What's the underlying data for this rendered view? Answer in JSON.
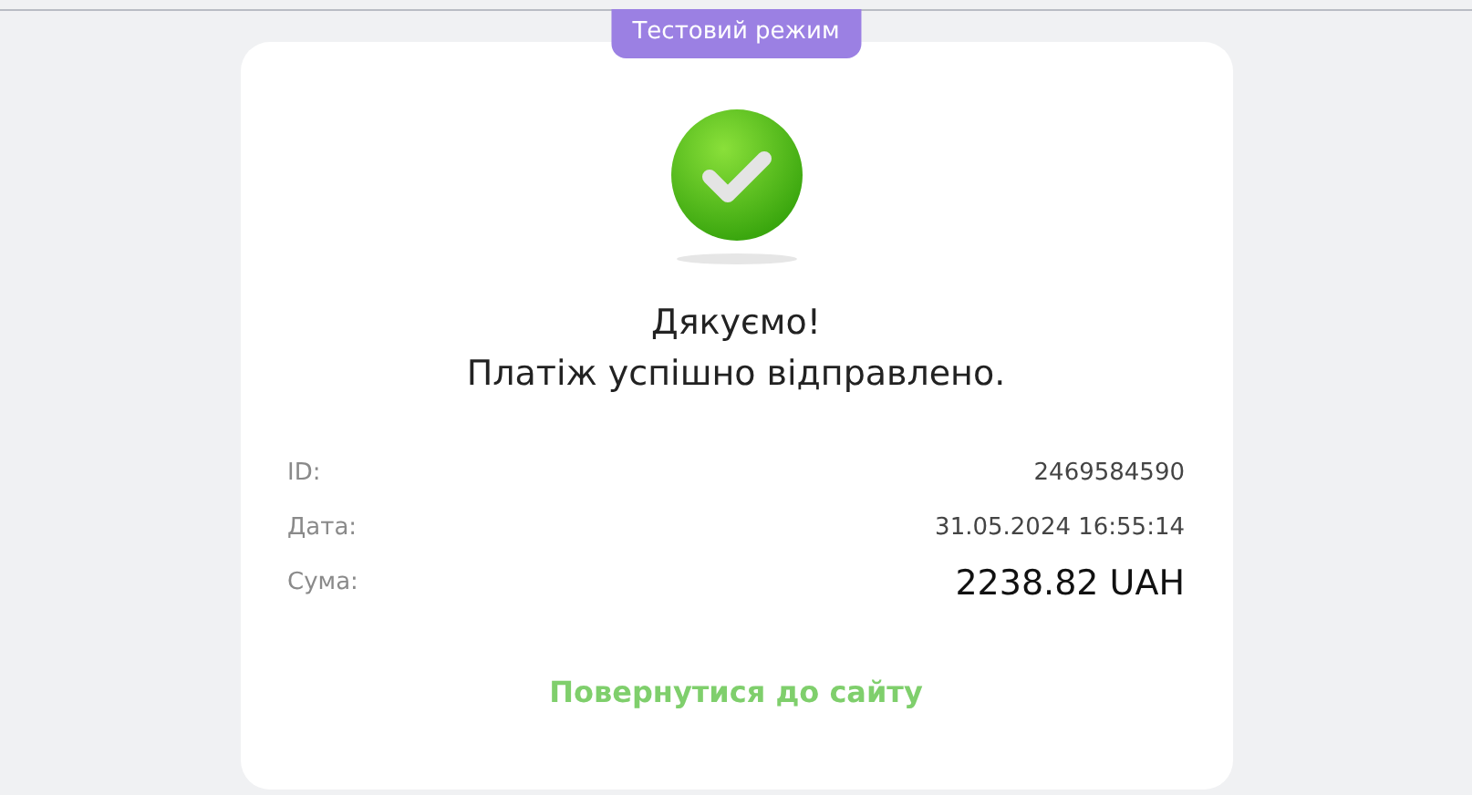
{
  "badge": {
    "label": "Тестовий режим"
  },
  "title": [
    "Дякуємо!",
    "Платіж успішно відправлено."
  ],
  "details": [
    {
      "label": "ID:",
      "value": "2469584590",
      "kind": "plain"
    },
    {
      "label": "Дата:",
      "value": "31.05.2024 16:55:14",
      "kind": "plain"
    },
    {
      "label": "Сума:",
      "value": "2238.82 UAH",
      "kind": "amount"
    }
  ],
  "return_link": {
    "label": "Повернутися до сайту"
  }
}
